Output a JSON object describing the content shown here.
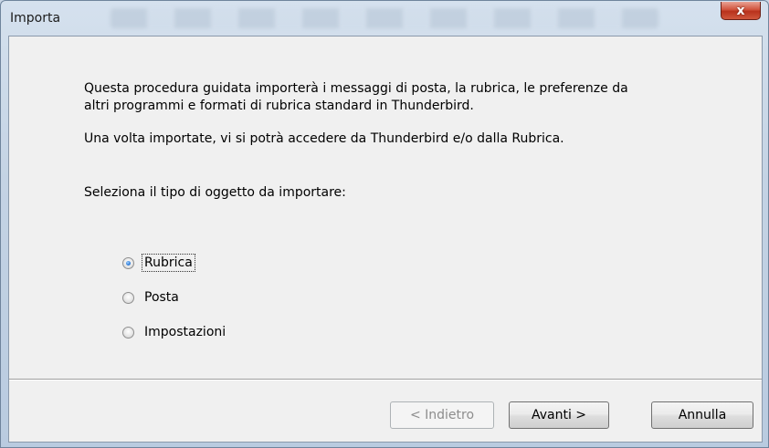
{
  "window": {
    "title": "Importa",
    "close_glyph": "x"
  },
  "content": {
    "intro_line1": "Questa procedura guidata importerà i messaggi di posta, la rubrica, le preferenze da",
    "intro_line2": "altri programmi e formati di rubrica standard in Thunderbird.",
    "intro_line3": "Una volta importate, vi si potrà accedere da Thunderbird e/o dalla Rubrica.",
    "select_label": "Seleziona il tipo di oggetto da importare:",
    "options": [
      {
        "label": "Rubrica",
        "checked": true
      },
      {
        "label": "Posta",
        "checked": false
      },
      {
        "label": "Impostazioni",
        "checked": false
      }
    ]
  },
  "buttons": {
    "back": "< Indietro",
    "next": "Avanti >",
    "cancel": "Annulla"
  }
}
